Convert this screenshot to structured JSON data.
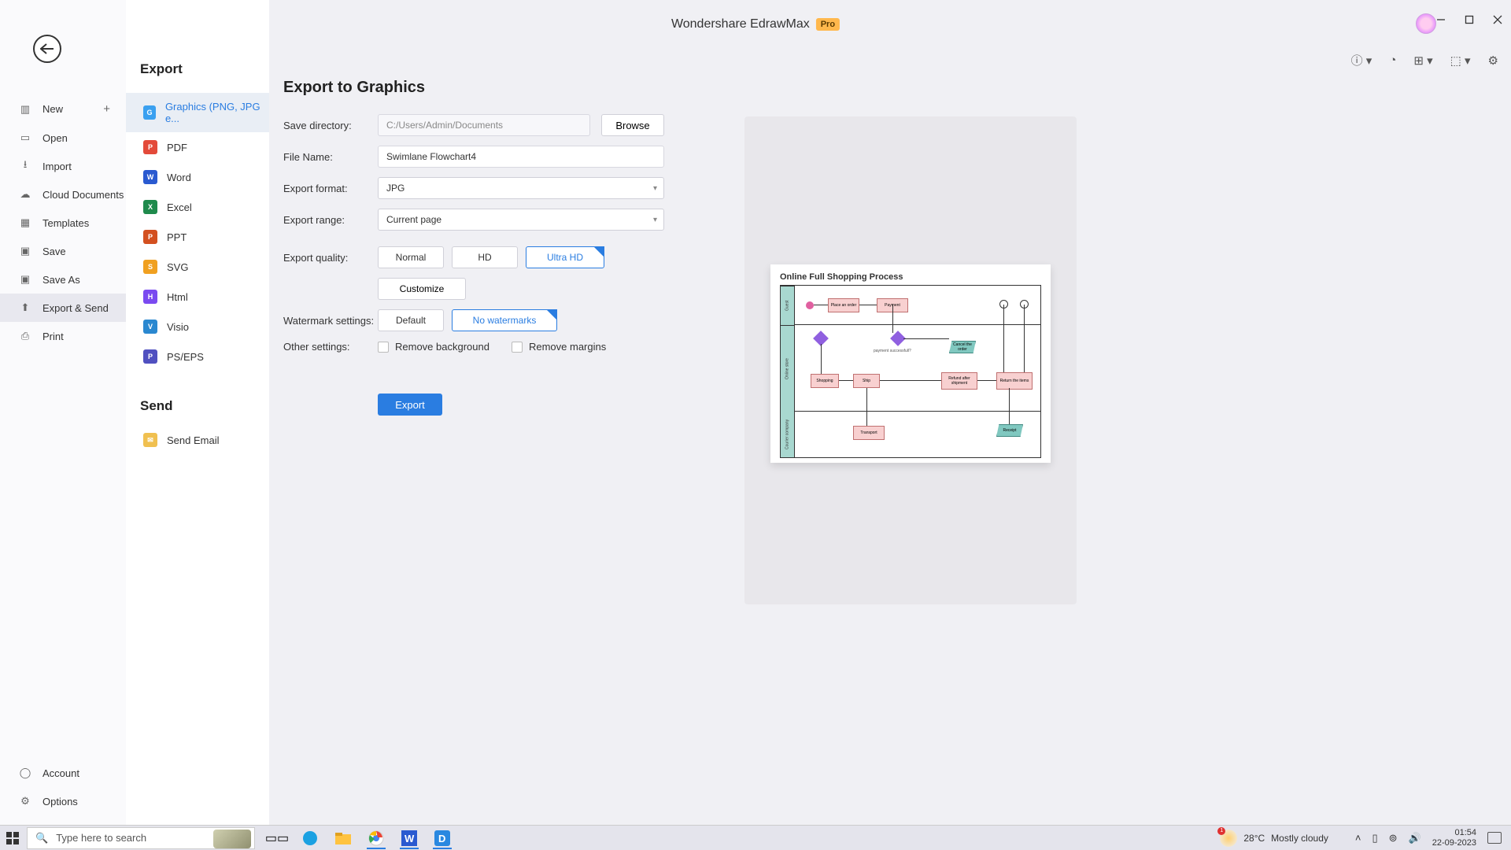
{
  "titlebar": {
    "app_name": "Wondershare EdrawMax",
    "pro": "Pro"
  },
  "left_nav": {
    "items": [
      {
        "label": "New"
      },
      {
        "label": "Open"
      },
      {
        "label": "Import"
      },
      {
        "label": "Cloud Documents"
      },
      {
        "label": "Templates"
      },
      {
        "label": "Save"
      },
      {
        "label": "Save As"
      },
      {
        "label": "Export & Send"
      },
      {
        "label": "Print"
      }
    ],
    "bottom": [
      {
        "label": "Account"
      },
      {
        "label": "Options"
      }
    ]
  },
  "mid": {
    "heading_export": "Export",
    "heading_send": "Send",
    "formats": [
      {
        "label": "Graphics (PNG, JPG e..."
      },
      {
        "label": "PDF"
      },
      {
        "label": "Word"
      },
      {
        "label": "Excel"
      },
      {
        "label": "PPT"
      },
      {
        "label": "SVG"
      },
      {
        "label": "Html"
      },
      {
        "label": "Visio"
      },
      {
        "label": "PS/EPS"
      }
    ],
    "send_items": [
      {
        "label": "Send Email"
      }
    ]
  },
  "main": {
    "title": "Export to Graphics",
    "labels": {
      "save_dir": "Save directory:",
      "file_name": "File Name:",
      "format": "Export format:",
      "range": "Export range:",
      "quality": "Export quality:",
      "watermark": "Watermark settings:",
      "other": "Other settings:"
    },
    "values": {
      "save_dir": "C:/Users/Admin/Documents",
      "browse": "Browse",
      "file_name": "Swimlane Flowchart4",
      "format": "JPG",
      "range": "Current page",
      "quality": {
        "normal": "Normal",
        "hd": "HD",
        "ultra": "Ultra HD"
      },
      "customize": "Customize",
      "watermark": {
        "default": "Default",
        "none": "No watermarks"
      },
      "remove_bg": "Remove background",
      "remove_margins": "Remove margins",
      "export": "Export"
    }
  },
  "preview": {
    "title": "Online Full Shopping Process",
    "lane_names": [
      "Guest",
      "Online store",
      "Courier company"
    ]
  },
  "taskbar": {
    "search_placeholder": "Type here to search",
    "weather_temp": "28°C",
    "weather_text": "Mostly cloudy",
    "weather_badge": "1",
    "time": "01:54",
    "date": "22-09-2023"
  }
}
